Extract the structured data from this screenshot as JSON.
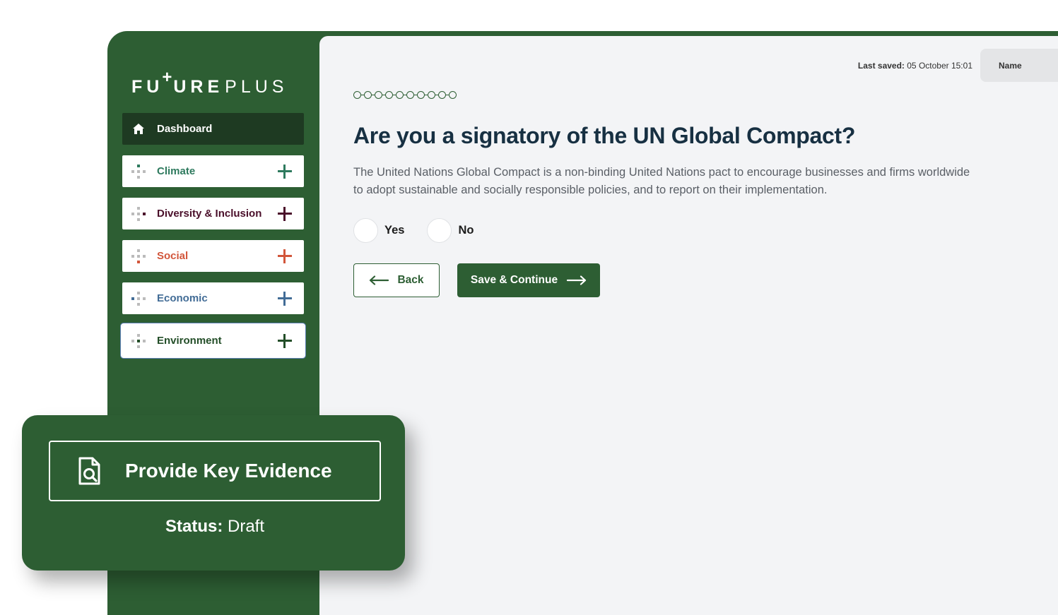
{
  "brand": {
    "logo_part1": "FU",
    "logo_plus": "+",
    "logo_part2": "URE",
    "logo_part3": "PLUS"
  },
  "sidebar": {
    "items": [
      {
        "label": "Dashboard",
        "icon": "home-icon",
        "color": "#ffffff"
      },
      {
        "label": "Climate",
        "icon": "grid-dots-icon",
        "color": "#2e7a5e"
      },
      {
        "label": "Diversity & Inclusion",
        "icon": "grid-dots-icon",
        "color": "#4a0f2a"
      },
      {
        "label": "Social",
        "icon": "grid-dots-icon",
        "color": "#d2563b"
      },
      {
        "label": "Economic",
        "icon": "grid-dots-icon",
        "color": "#426c96"
      },
      {
        "label": "Environment",
        "icon": "grid-dots-icon",
        "color": "#234e28"
      }
    ]
  },
  "header": {
    "last_saved_label": "Last saved:",
    "last_saved_value": " 05 October 15:01",
    "name_label": "Name"
  },
  "progress": {
    "total_steps": 10
  },
  "question": {
    "title": "Are you a signatory of the UN Global Compact?",
    "description": "The United Nations Global Compact is a non-binding United Nations pact to encourage businesses and firms worldwide to adopt sustainable and socially responsible policies, and to report on their implementation.",
    "options": [
      "Yes",
      "No"
    ]
  },
  "actions": {
    "back_label": "Back",
    "save_label": "Save & Continue"
  },
  "evidence": {
    "button_label": "Provide Key Evidence",
    "status_key": "Status:",
    "status_value": " Draft"
  },
  "colors": {
    "brand_green": "#2d5e33",
    "dark_green": "#1e3a22",
    "heading_navy": "#173042"
  }
}
